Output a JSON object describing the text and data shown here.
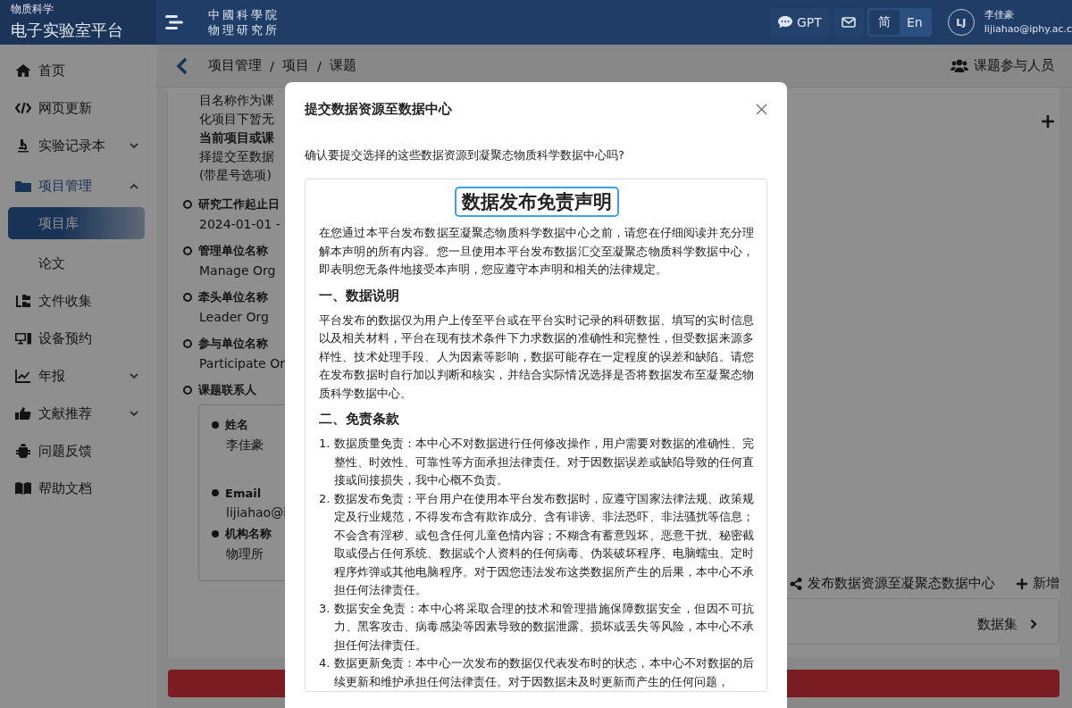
{
  "header": {
    "brand_top": "物质科学",
    "brand_title": "电子实验室平台",
    "logo_lines": [
      "中國科學院",
      "物理研究所"
    ],
    "gpt_label": "GPT",
    "languages": [
      {
        "label": "简",
        "selected": true
      },
      {
        "label": "En",
        "selected": false
      }
    ],
    "user": {
      "initials": "LJ",
      "name": "李佳豪",
      "email": "lijiahao@iphy.ac.c"
    }
  },
  "sidebar": {
    "items": [
      {
        "label": "首页"
      },
      {
        "label": "网页更新"
      },
      {
        "label": "实验记录本",
        "expanded": false
      },
      {
        "label": "项目管理",
        "expanded": true,
        "children": [
          {
            "label": "项目库",
            "selected": true
          },
          {
            "label": "论文",
            "selected": false
          }
        ]
      },
      {
        "label": "文件收集"
      },
      {
        "label": "设备预约"
      },
      {
        "label": "年报",
        "expanded": false
      },
      {
        "label": "文献推荐",
        "expanded": false
      },
      {
        "label": "问题反馈"
      },
      {
        "label": "帮助文档"
      }
    ]
  },
  "breadcrumb": [
    {
      "kind": "link",
      "text": "项目管理"
    },
    {
      "kind": "separator",
      "text": "/"
    },
    {
      "kind": "link",
      "text": "项目"
    },
    {
      "kind": "separator",
      "text": "/"
    },
    {
      "kind": "link",
      "text": "课题"
    }
  ],
  "participants_label": "课题参与人员",
  "content": {
    "intro_lines": [
      {
        "text": "目名称作为课",
        "kind": "plain"
      },
      {
        "text": "化项目下暂无",
        "kind": "plain"
      },
      {
        "text": "当前项目或课",
        "kind": "bold"
      },
      {
        "text": "择提交至数据",
        "kind": "plain"
      },
      {
        "text": "(带星号选项)",
        "kind": "plain"
      }
    ],
    "fields": [
      {
        "label": "研究工作起止日",
        "value": "2024-01-01 -"
      },
      {
        "label": "管理单位名称",
        "value": "Manage Org"
      },
      {
        "label": "牵头单位名称",
        "value": "Leader Org"
      },
      {
        "label": "参与单位名称",
        "value": "Participate Or"
      }
    ],
    "contact": {
      "label": "课题联系人",
      "fields": [
        {
          "label": "姓名",
          "value": "李佳豪"
        },
        {
          "label": "Email",
          "value": "lijiahao@i"
        },
        {
          "label": "机构名称",
          "value": "物理所"
        }
      ]
    },
    "publish_label": "发布数据资源至凝聚态数据中心",
    "add_label": "新增",
    "dataset_label": "数据集"
  },
  "modal": {
    "title": "提交数据资源至数据中心",
    "question": "确认要提交选择的这些数据资源到凝聚态物质科学数据中心吗?",
    "notice": {
      "title": "数据发布免责声明",
      "intro": "在您通过本平台发布数据至凝聚态物质科学数据中心之前，请您在仔细阅读并充分理解本声明的所有内容。您一旦使用本平台发布数据汇交至凝聚态物质科学数据中心，即表明您无条件地接受本声明，您应遵守本声明和相关的法律规定。",
      "sections": [
        {
          "heading": "一、数据说明",
          "kind": "paragraph",
          "paragraphs": [
            "平台发布的数据仅为用户上传至平台或在平台实时记录的科研数据、填写的实时信息以及相关材料，平台在现有技术条件下力求数据的准确性和完整性，但受数据来源多样性、技术处理手段、人为因素等影响，数据可能存在一定程度的误差和缺陷。请您在发布数据时自行加以判断和核实，并结合实际情况选择是否将数据发布至凝聚态物质科学数据中心。"
          ]
        },
        {
          "heading": "二、免责条款",
          "kind": "list",
          "items": [
            {
              "number": "1.",
              "text": "数据质量免责：本中心不对数据进行任何修改操作，用户需要对数据的准确性、完整性、时效性、可靠性等方面承担法律责任。对于因数据误差或缺陷导致的任何直接或间接损失，我中心概不负责。"
            },
            {
              "number": "2.",
              "text": "数据发布免责：平台用户在使用本平台发布数据时，应遵守国家法律法规、政策规定及行业规范，不得发布含有欺诈成分、含有诽谤、非法恐吓、非法骚扰等信息；不会含有淫秽、或包含任何儿童色情内容；不糊含有蓄意毁坏、恶意干扰、秘密截取或侵占任何系统、数据或个人资料的任何病毒、伪装破坏程序、电脑蠕虫、定时程序炸弹或其他电脑程序。对于因您违法发布这类数据所产生的后果，本中心不承担任何法律责任。"
            },
            {
              "number": "3.",
              "text": "数据安全免责：本中心将采取合理的技术和管理措施保障数据安全，但因不可抗力、黑客攻击、病毒感染等因素导致的数据泄露、损坏或丢失等风险，本中心不承担任何法律责任。"
            },
            {
              "number": "4.",
              "text": "数据更新免责：本中心一次发布的数据仅代表发布时的状态，本中心不对数据的后续更新和维护承担任何法律责任。对于因数据未及时更新而产生的任何问题，"
            }
          ]
        }
      ]
    }
  }
}
